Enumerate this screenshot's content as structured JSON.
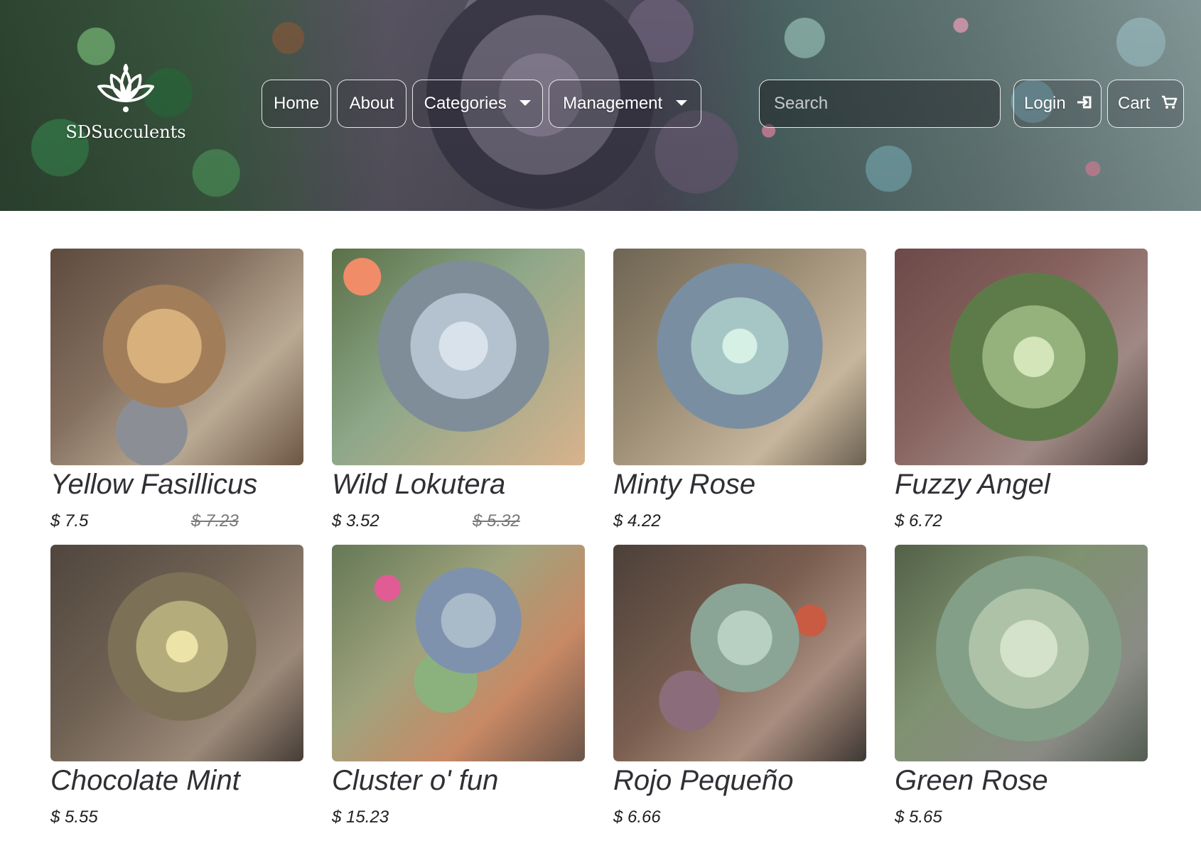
{
  "brand": {
    "name": "SDSucculents",
    "logo_icon": "lotus-icon"
  },
  "nav": {
    "home": "Home",
    "about": "About",
    "categories": "Categories",
    "management": "Management",
    "login": "Login",
    "cart": "Cart",
    "dropdown_icon": "chevron-down-icon",
    "login_icon": "login-icon",
    "cart_icon": "cart-icon"
  },
  "search": {
    "placeholder": "Search"
  },
  "products": [
    {
      "name": "Yellow Fasillicus",
      "price": "$ 7.5",
      "old_price": "$ 7.23"
    },
    {
      "name": "Wild Lokutera",
      "price": "$ 3.52",
      "old_price": "$ 5.32"
    },
    {
      "name": "Minty Rose",
      "price": "$ 4.22"
    },
    {
      "name": "Fuzzy Angel",
      "price": "$ 6.72"
    },
    {
      "name": "Chocolate Mint",
      "price": "$ 5.55"
    },
    {
      "name": "Cluster o' fun",
      "price": "$ 15.23"
    },
    {
      "name": "Rojo Pequeño",
      "price": "$ 6.66"
    },
    {
      "name": "Green Rose",
      "price": "$ 5.65"
    }
  ]
}
